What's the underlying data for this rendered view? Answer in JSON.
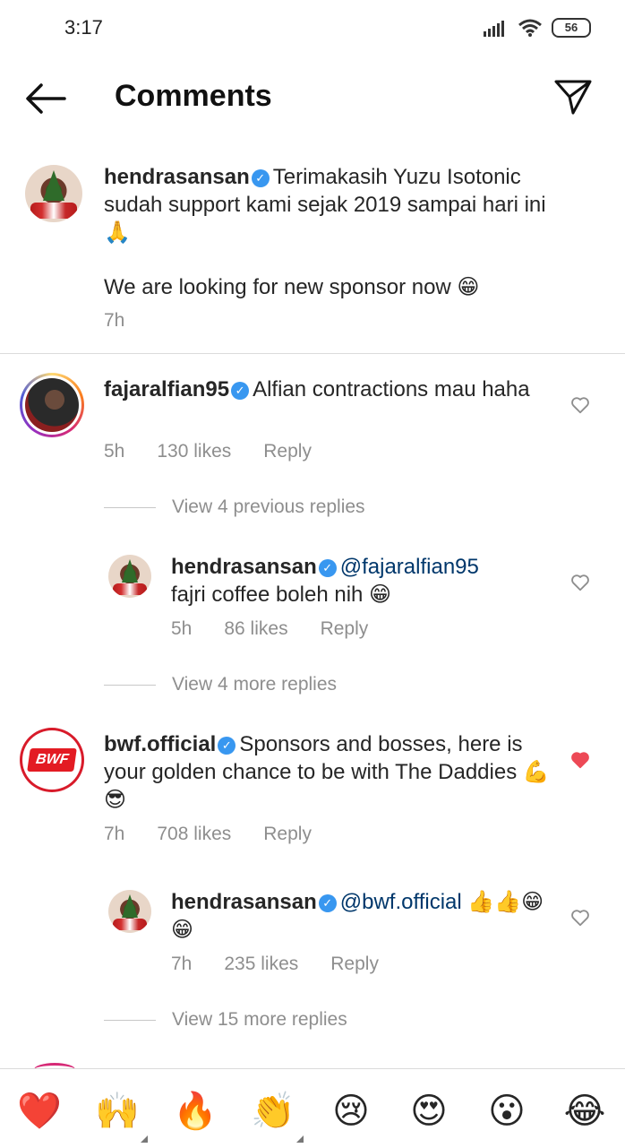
{
  "status": {
    "time": "3:17",
    "battery": "56"
  },
  "header": {
    "title": "Comments"
  },
  "caption": {
    "username": "hendrasansan",
    "text": "Terimakasih Yuzu Isotonic sudah support kami sejak 2019 sampai hari ini 🙏",
    "text2": "We are looking for new sponsor now 😁",
    "time": "7h"
  },
  "comments": [
    {
      "username": "fajaralfian95",
      "text": "Alfian contractions mau haha",
      "time": "5h",
      "likes": "130 likes",
      "reply_label": "Reply",
      "liked": false,
      "view_previous": "View 4 previous replies",
      "replies": [
        {
          "username": "hendrasansan",
          "mention": "@fajaralfian95",
          "text": "fajri coffee boleh nih 😁",
          "time": "5h",
          "likes": "86 likes",
          "reply_label": "Reply",
          "liked": false
        }
      ],
      "view_more": "View 4 more replies"
    },
    {
      "username": "bwf.official",
      "text": "Sponsors and bosses, here is your golden chance to be with The Daddies 💪😎",
      "time": "7h",
      "likes": "708 likes",
      "reply_label": "Reply",
      "liked": true,
      "avatar_logo": "BWF",
      "replies": [
        {
          "username": "hendrasansan",
          "mention": "@bwf.official",
          "text": "👍👍😁😁",
          "time": "7h",
          "likes": "235 likes",
          "reply_label": "Reply",
          "liked": false
        }
      ],
      "view_more": "View 15 more replies"
    }
  ],
  "emoji_bar": [
    "❤️",
    "🙌",
    "🔥",
    "👏",
    "😢",
    "😍",
    "😮",
    "😂"
  ],
  "colors": {
    "accent": "#3897f0",
    "heart_liked": "#ed4956",
    "mention": "#00376b",
    "meta": "#8e8e8e"
  }
}
